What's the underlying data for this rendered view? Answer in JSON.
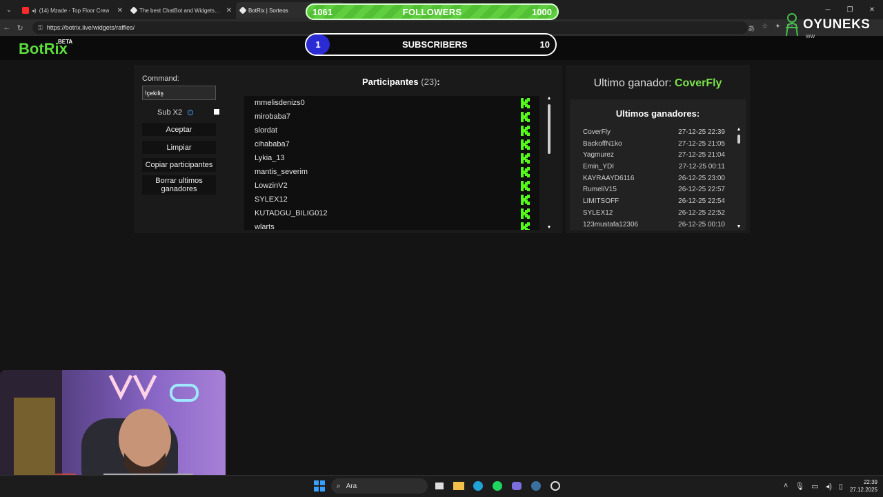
{
  "browser": {
    "tabs": [
      {
        "title": "(14) Mzade - Top Floor Crew",
        "favicon_color": "#ff2b2b",
        "active": false
      },
      {
        "title": "The best ChatBot and Widgets for",
        "favicon_color": "#e8e8e8",
        "active": false
      },
      {
        "title": "BotRix | Sorteos",
        "favicon_color": "#e8e8e8",
        "active": true
      }
    ],
    "url": "https://botrix.live/widgets/raffles/"
  },
  "overlay": {
    "followers": {
      "current": "1061",
      "label": "FOLLOWERS",
      "goal": "1000"
    },
    "subscribers": {
      "current": "1",
      "label": "SUBSCRIBERS",
      "goal": "10"
    },
    "watermark": {
      "brand": "OYUNEKS",
      "sub": "WW"
    }
  },
  "site": {
    "logo": "BotRix",
    "logo_badge": "BETA"
  },
  "raffle": {
    "command_label": "Command:",
    "command_value": "!çekiliş",
    "subx2_label": "Sub X2",
    "buttons": {
      "accept": "Aceptar",
      "clear": "Limpiar",
      "copy": "Copiar participantes",
      "delete_winners": "Borrar ultimos ganadores"
    },
    "participants_label": "Participantes",
    "participants_count": "(23)",
    "participants_colon": ":",
    "participants": [
      "mmelisdenizs0",
      "mirobaba7",
      "slordat",
      "cihababa7",
      "Lykia_13",
      "mantis_severim",
      "LowzinV2",
      "SYLEX12",
      "KUTADGU_BILIG012",
      "wlarts"
    ]
  },
  "winners": {
    "last_winner_label": "Ultimo ganador:",
    "last_winner_name": "CoverFly",
    "list_title": "Ultimos ganadores:",
    "list": [
      {
        "name": "CoverFly",
        "date": "27-12-25 22:39"
      },
      {
        "name": "BackoffN1ko",
        "date": "27-12-25 21:05"
      },
      {
        "name": "Yagmurez",
        "date": "27-12-25 21:04"
      },
      {
        "name": "Emin_YDI",
        "date": "27-12-25 00:11"
      },
      {
        "name": "KAYRAAYD6116",
        "date": "26-12-25 23:00"
      },
      {
        "name": "RumeliV15",
        "date": "26-12-25 22:57"
      },
      {
        "name": "LIMITSOFF",
        "date": "26-12-25 22:54"
      },
      {
        "name": "SYLEX12",
        "date": "26-12-25 22:52"
      },
      {
        "name": "123mustafa12306",
        "date": "26-12-25 00:10"
      }
    ]
  },
  "taskbar": {
    "search_placeholder": "Ara",
    "time": "22:39",
    "date": "27.12.2025"
  },
  "colors": {
    "accent_green": "#5cdc3c",
    "kick_green": "#53fc18",
    "subs_blue": "#2b2bd6"
  }
}
